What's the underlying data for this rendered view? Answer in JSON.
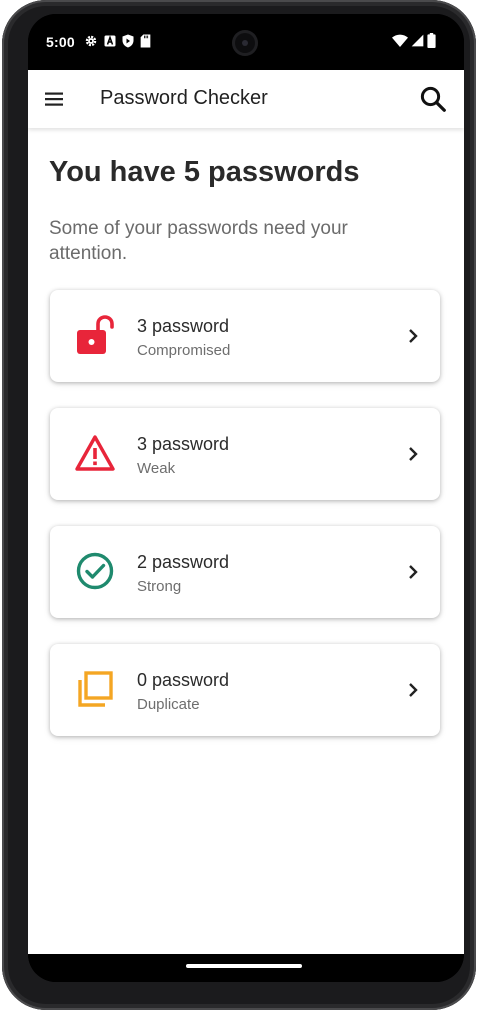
{
  "status_bar": {
    "time": "5:00",
    "left_icons": [
      "settings-icon",
      "a-icon",
      "shield-icon",
      "sd-card-icon"
    ],
    "right_icons": [
      "wifi-icon",
      "signal-icon",
      "battery-icon"
    ]
  },
  "app_bar": {
    "title": "Password Checker",
    "menu_icon": "menu-icon",
    "search_icon": "search-icon"
  },
  "main": {
    "heading": "You have 5 passwords",
    "subtext": "Some of your passwords need your attention."
  },
  "categories": [
    {
      "count": "3 password",
      "label": "Compromised",
      "icon": "unlocked-padlock-icon",
      "color": "#e8253a"
    },
    {
      "count": "3 password",
      "label": "Weak",
      "icon": "warning-icon",
      "color": "#e8253a"
    },
    {
      "count": "2 password",
      "label": "Strong",
      "icon": "check-circle-icon",
      "color": "#1f8a6e"
    },
    {
      "count": "0 password",
      "label": "Duplicate",
      "icon": "duplicate-icon",
      "color": "#f4a623"
    }
  ]
}
